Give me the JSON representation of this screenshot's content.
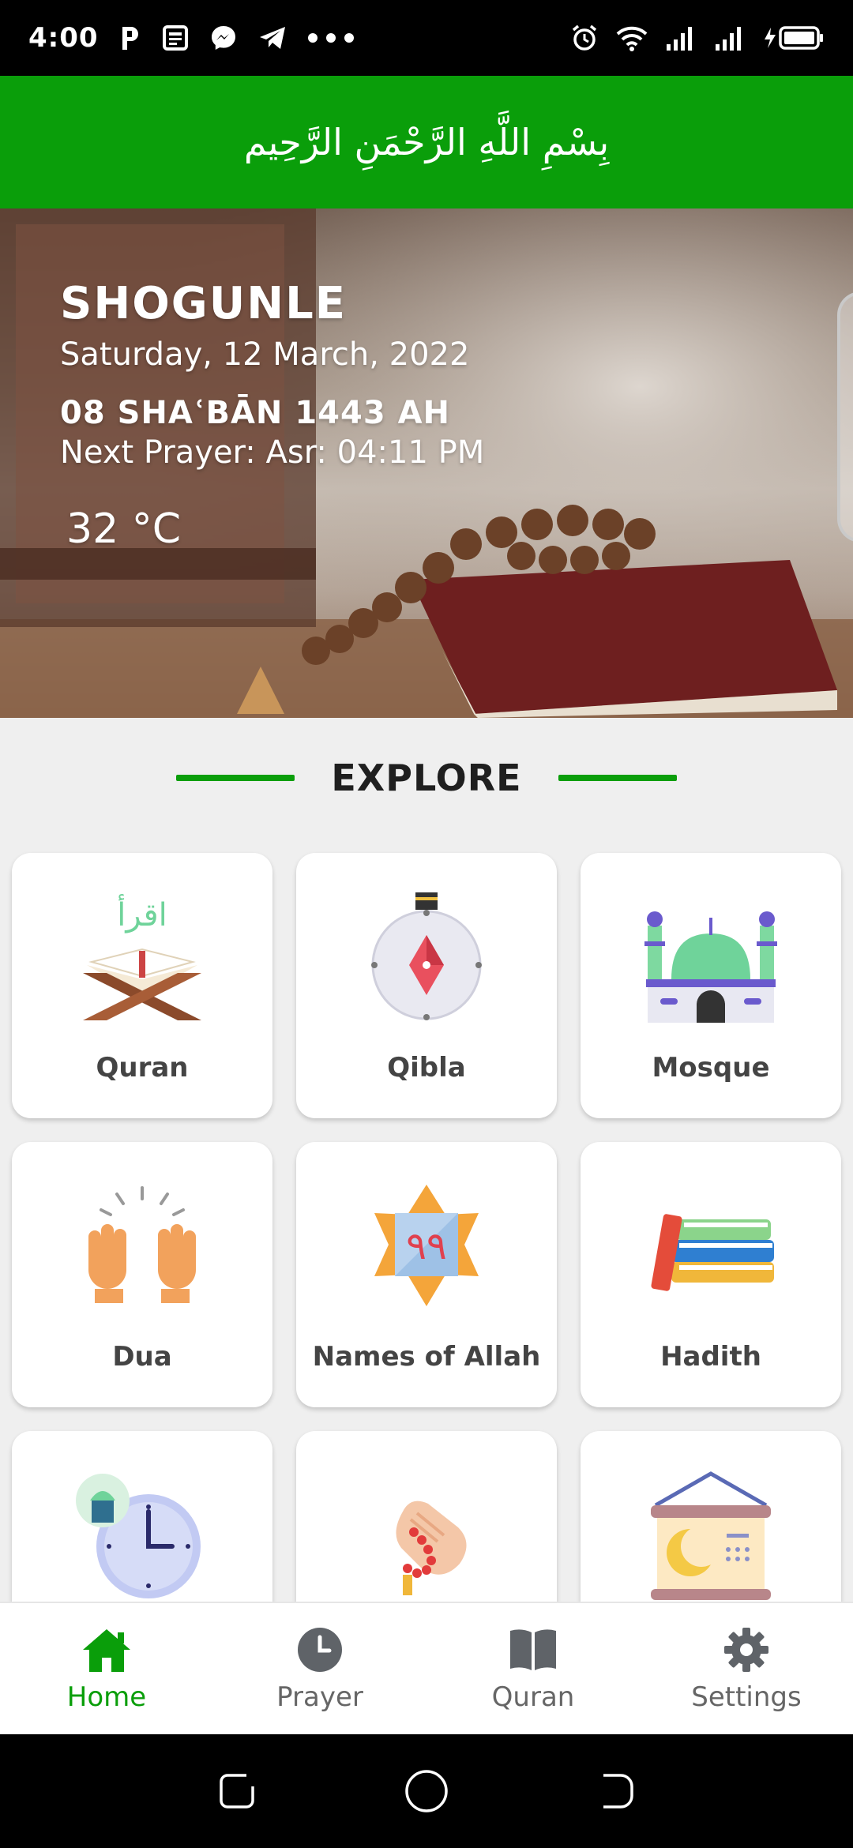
{
  "status_bar": {
    "time": "4:00",
    "notification_icons": [
      "p-app-icon",
      "news-icon",
      "messenger-icon",
      "telegram-icon",
      "more-dots-icon"
    ],
    "right_icons": [
      "alarm-icon",
      "wifi-icon",
      "signal-icon",
      "signal-icon",
      "battery-charging-icon"
    ]
  },
  "header": {
    "bismillah": "بِسْمِ اللَّهِ الرَّحْمَنِ الرَّحِيم"
  },
  "hero": {
    "city": "SHOGUNLE",
    "gregorian_date": "Saturday, 12 March, 2022",
    "hijri_date": "08 SHAʿBĀN 1443 AH",
    "next_prayer": "Next Prayer: Asr: 04:11 PM",
    "temperature": "32 °C"
  },
  "explore": {
    "title": "EXPLORE",
    "items": [
      {
        "label": "Quran",
        "icon": "quran-icon"
      },
      {
        "label": "Qibla",
        "icon": "compass-icon"
      },
      {
        "label": "Mosque",
        "icon": "mosque-icon"
      },
      {
        "label": "Dua",
        "icon": "praying-hands-icon"
      },
      {
        "label": "Names of Allah",
        "icon": "names-star-icon",
        "icon_text": "٩٩"
      },
      {
        "label": "Hadith",
        "icon": "books-icon"
      },
      {
        "label": "",
        "icon": "prayer-clock-icon"
      },
      {
        "label": "",
        "icon": "tasbih-hand-icon"
      },
      {
        "label": "",
        "icon": "calendar-icon"
      }
    ]
  },
  "bottom_nav": {
    "items": [
      {
        "label": "Home",
        "icon": "home-icon",
        "active": true
      },
      {
        "label": "Prayer",
        "icon": "clock-icon",
        "active": false
      },
      {
        "label": "Quran",
        "icon": "book-icon",
        "active": false
      },
      {
        "label": "Settings",
        "icon": "gear-icon",
        "active": false
      }
    ]
  },
  "colors": {
    "primary_green": "#0a9e0a",
    "background": "#efefef",
    "card": "#ffffff"
  }
}
